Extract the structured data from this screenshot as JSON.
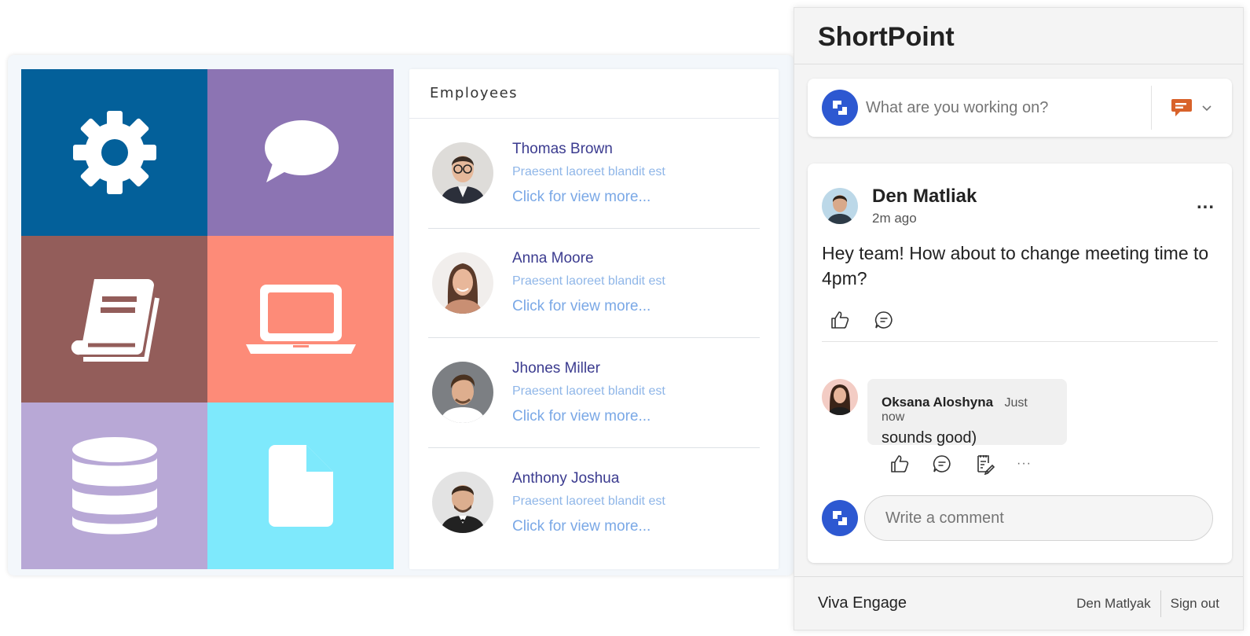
{
  "colors": {
    "tile_settings": "#03609a",
    "tile_chat": "#8c74b3",
    "tile_book": "#935d5a",
    "tile_laptop": "#fd8b78",
    "tile_database": "#b8a8d6",
    "tile_file": "#7ee9fc",
    "employee_name": "#3b3b8f",
    "employee_sub": "#8fb6e8",
    "employee_link": "#7aa8e6",
    "badge_blue": "#2d58d1",
    "chat_orange": "#d8622a"
  },
  "tiles": [
    {
      "icon": "gear-icon"
    },
    {
      "icon": "speech-bubble-icon"
    },
    {
      "icon": "book-icon"
    },
    {
      "icon": "laptop-icon"
    },
    {
      "icon": "database-icon"
    },
    {
      "icon": "file-icon"
    }
  ],
  "employees": {
    "title": "Employees",
    "list": [
      {
        "name": "Thomas Brown",
        "subtitle": "Praesent laoreet blandit est",
        "link": "Click for view more..."
      },
      {
        "name": "Anna Moore",
        "subtitle": "Praesent laoreet blandit est",
        "link": "Click for view more..."
      },
      {
        "name": "Jhones Miller",
        "subtitle": "Praesent laoreet blandit est",
        "link": "Click for view more..."
      },
      {
        "name": "Anthony Joshua",
        "subtitle": "Praesent laoreet blandit est",
        "link": "Click for view more..."
      }
    ]
  },
  "engage": {
    "header_title": "ShortPoint",
    "compose_placeholder": "What are you working on?",
    "post": {
      "author": "Den Matliak",
      "time": "2m ago",
      "body": "Hey team! How about to change meeting time to 4pm?",
      "more": "..."
    },
    "comment": {
      "author": "Oksana Aloshyna",
      "time": "Just now",
      "text": "sounds good)",
      "more": "···"
    },
    "reply_placeholder": "Write a comment",
    "footer": {
      "brand": "Viva Engage",
      "user": "Den Matlyak",
      "signout": "Sign out"
    }
  }
}
